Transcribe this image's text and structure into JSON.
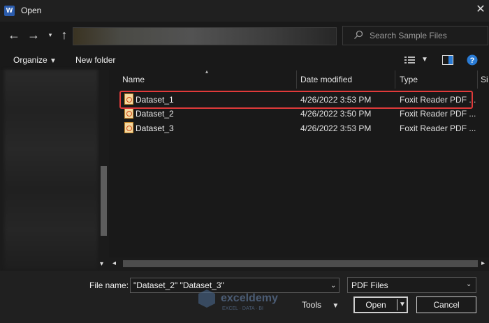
{
  "window": {
    "title": "Open",
    "app_icon_letter": "W"
  },
  "nav": {
    "search_placeholder": "Search Sample Files"
  },
  "toolbar": {
    "organize_label": "Organize",
    "new_folder_label": "New folder"
  },
  "columns": [
    "Name",
    "Date modified",
    "Type",
    "Si"
  ],
  "files": [
    {
      "name": "Dataset_1",
      "date": "4/26/2022 3:53 PM",
      "type": "Foxit Reader PDF ...",
      "highlighted": true
    },
    {
      "name": "Dataset_2",
      "date": "4/26/2022 3:50 PM",
      "type": "Foxit Reader PDF ...",
      "highlighted": false
    },
    {
      "name": "Dataset_3",
      "date": "4/26/2022 3:53 PM",
      "type": "Foxit Reader PDF ...",
      "highlighted": false
    }
  ],
  "bottom": {
    "file_name_label": "File name:",
    "file_name_value": "\"Dataset_2\" \"Dataset_3\"",
    "file_type_value": "PDF Files",
    "tools_label": "Tools",
    "open_label": "Open",
    "cancel_label": "Cancel"
  },
  "watermark": {
    "brand": "exceldemy",
    "tagline": "EXCEL · DATA · BI"
  },
  "colors": {
    "highlight": "#e03a3a",
    "help": "#2a7bd4"
  },
  "icons": [
    "word-app-icon",
    "close-icon",
    "back-arrow-icon",
    "forward-arrow-icon",
    "recent-dropdown-icon",
    "up-arrow-icon",
    "search-icon",
    "view-options-icon",
    "preview-pane-icon",
    "help-icon",
    "pdf-file-icon",
    "chevron-down-icon"
  ]
}
